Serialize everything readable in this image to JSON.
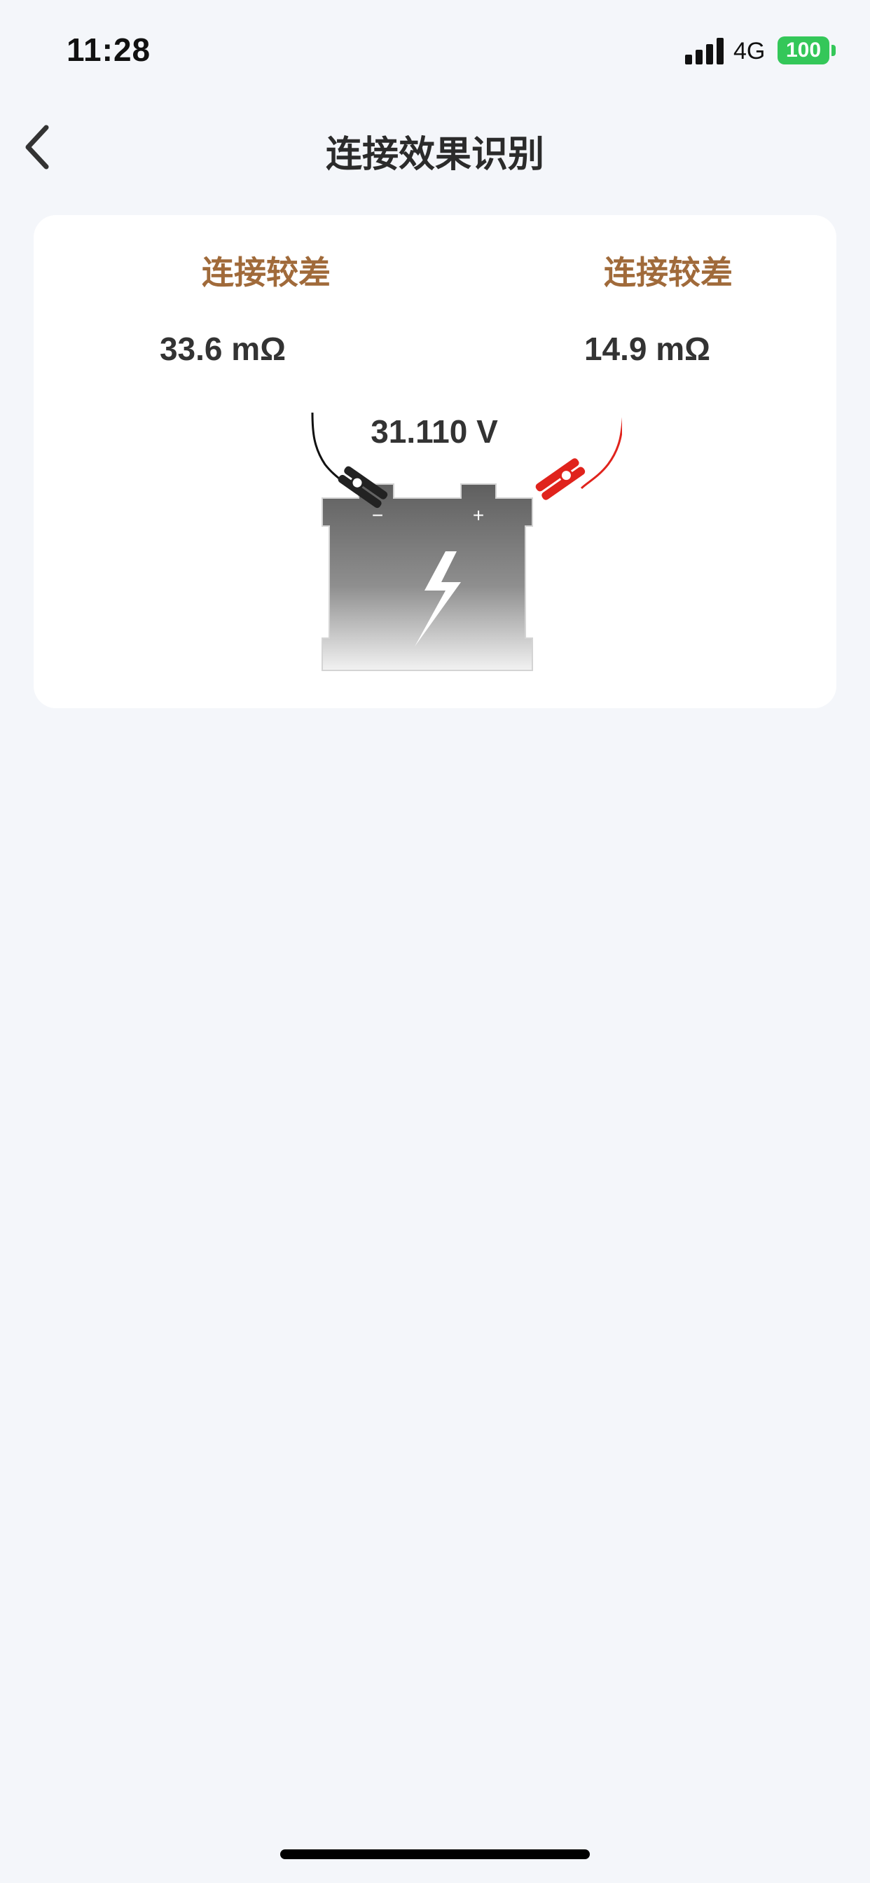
{
  "status_bar": {
    "time": "11:28",
    "network": "4G",
    "battery_level": "100",
    "battery_color": "#34c759"
  },
  "nav": {
    "title": "连接效果识别",
    "back_icon": "chevron-left-icon"
  },
  "card": {
    "left": {
      "status": "连接较差",
      "resistance": "33.6 mΩ"
    },
    "right": {
      "status": "连接较差",
      "resistance": "14.9 mΩ"
    },
    "voltage": "31.110 V",
    "negative_symbol": "−",
    "positive_symbol": "+",
    "status_color": "#a06a3a"
  }
}
